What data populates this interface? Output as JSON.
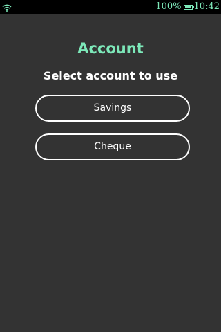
{
  "status_bar": {
    "wifi_icon": "wifi-icon",
    "battery_text": "100%",
    "battery_icon": "battery-icon",
    "time": "10:42",
    "text_color": "#7de8b9"
  },
  "screen": {
    "title": "Account",
    "subtitle": "Select account to use",
    "accent_color": "#7de8b9",
    "background_color": "#333333"
  },
  "accounts": [
    {
      "label": "Savings"
    },
    {
      "label": "Cheque"
    }
  ]
}
